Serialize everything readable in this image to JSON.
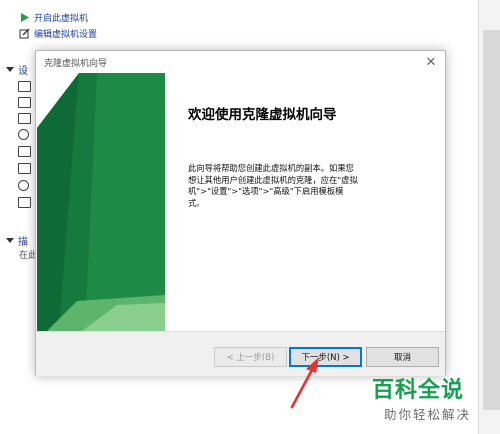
{
  "background": {
    "actions": [
      {
        "label": "开启此虚拟机",
        "icon": "play-icon"
      },
      {
        "label": "编辑虚拟机设置",
        "icon": "edit-settings-icon"
      }
    ],
    "devices_section_fragment": "设",
    "description_section_fragment": "描",
    "description_text_fragment": "在此"
  },
  "wizard": {
    "title": "克隆虚拟机向导",
    "close_symbol": "✕",
    "heading": "欢迎使用克隆虚拟机向导",
    "body": "此向导将帮助您创建此虚拟机的副本。如果您想让其他用户创建此虚拟机的克隆，应在\"虚拟机\">\"设置\">\"选项\">\"高级\"下启用模板模式。",
    "buttons": {
      "back": "< 上一步(B)",
      "next": "下一步(N) >",
      "cancel": "取消"
    },
    "colors": {
      "banner_dark": "#0f6b35",
      "banner_mid": "#1d8a45",
      "banner_light": "#5cb56a",
      "default_button_border": "#0078d7"
    }
  },
  "annotation": {
    "arrow_color": "#e8302c"
  },
  "watermark": {
    "title": "百科全说",
    "subtitle": "助你轻松解决",
    "color": "#14a04f"
  }
}
